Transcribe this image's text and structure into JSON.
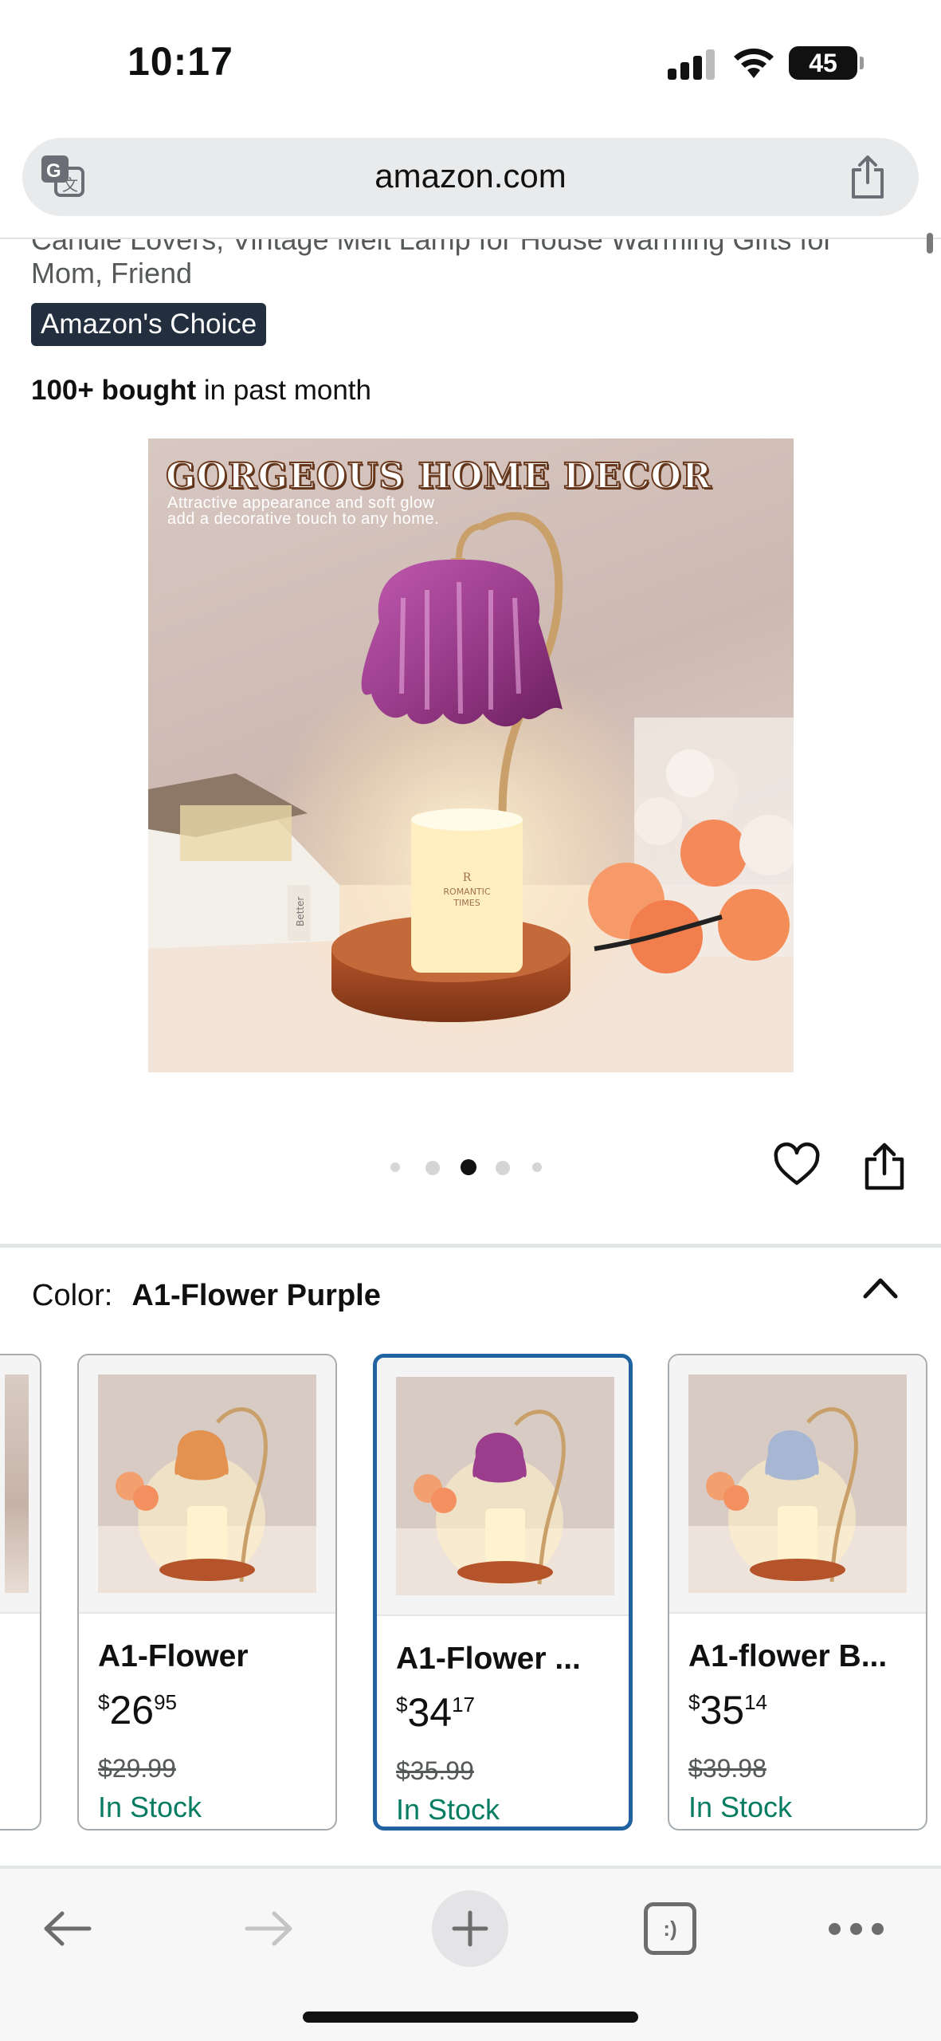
{
  "status_bar": {
    "time": "10:17",
    "battery": "45"
  },
  "browser": {
    "url": "amazon.com"
  },
  "product": {
    "title_partial_line1": "Candle Lovers, Vintage Melt Lamp for House Warming Gifts for",
    "title_partial_line2": "Mom, Friend",
    "badge": "Amazon's Choice",
    "bought_bold": "100+ bought",
    "bought_rest": " in past month",
    "image": {
      "headline": "GORGEOUS HOME DECOR",
      "subline1": "Attractive appearance and soft glow",
      "subline2": "add a decorative touch to any home.",
      "candle_brand_mark": "R",
      "candle_label1": "ROMANTIC",
      "candle_label2": "TIMES",
      "book_spine": "Better"
    },
    "carousel": {
      "dot_count": 5,
      "active_index": 2
    }
  },
  "color_selector": {
    "label": "Color:",
    "selected_value": "A1-Flower Purple",
    "variants": [
      {
        "name": "A1-Flower",
        "price_symbol": "$",
        "price_whole": "26",
        "price_fraction": "95",
        "list_price": "$29.99",
        "stock": "In Stock",
        "shade_color": "#e3924f",
        "selected": false
      },
      {
        "name": "A1-Flower ...",
        "price_symbol": "$",
        "price_whole": "34",
        "price_fraction": "17",
        "list_price": "$35.99",
        "stock": "In Stock",
        "shade_color": "#9b3d8c",
        "selected": true
      },
      {
        "name": "A1-flower B...",
        "price_symbol": "$",
        "price_whole": "35",
        "price_fraction": "14",
        "list_price": "$39.98",
        "stock": "In Stock",
        "shade_color": "#a7b7d3",
        "selected": false
      }
    ]
  },
  "toolbar": {
    "tabs_glyph": ":)"
  },
  "colors": {
    "badge_bg": "#232f3e",
    "stock_green": "#067d62",
    "selected_border": "#2162a1"
  }
}
